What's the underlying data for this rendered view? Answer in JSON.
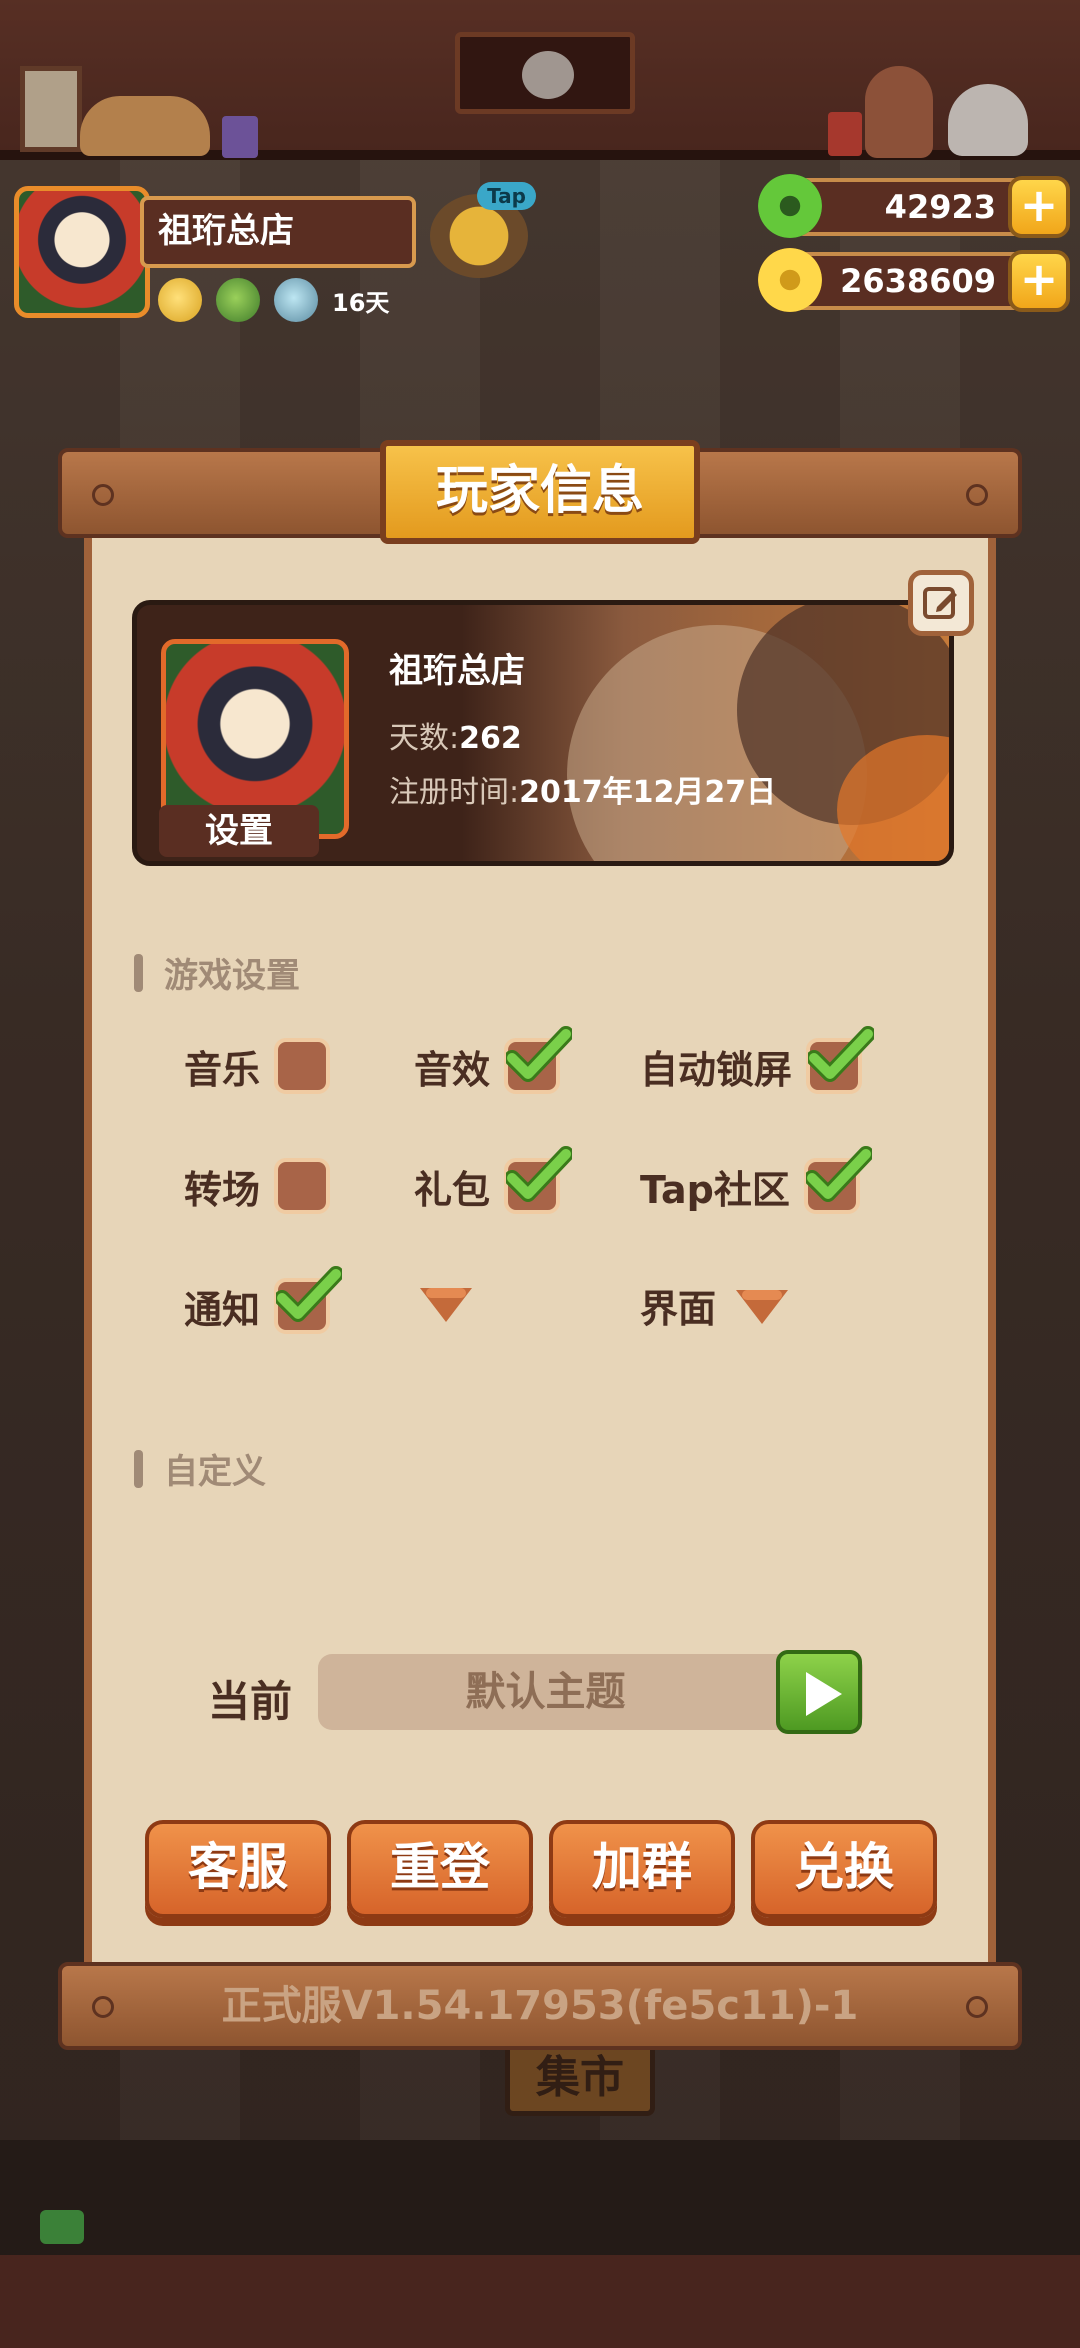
{
  "hud": {
    "shop_name": "祖珩总店",
    "tap_badge": "Tap",
    "days_label": "16天",
    "jade": "42923",
    "coins": "2638609",
    "plus": "+"
  },
  "panel": {
    "title": "玩家信息",
    "profile": {
      "name": "祖珩总店",
      "days_label": "天数:",
      "days_value": "262",
      "register_label": "注册时间:",
      "register_value": "2017年12月27日",
      "settings_button": "设置"
    },
    "game_settings": {
      "heading": "游戏设置",
      "options": [
        {
          "label": "音乐",
          "checked": false
        },
        {
          "label": "音效",
          "checked": true
        },
        {
          "label": "自动锁屏",
          "checked": true
        },
        {
          "label": "转场",
          "checked": false
        },
        {
          "label": "礼包",
          "checked": true
        },
        {
          "label": "Tap社区",
          "checked": true
        },
        {
          "label": "通知",
          "checked": true
        },
        {
          "label": "",
          "type": "dropdown"
        },
        {
          "label": "界面",
          "type": "dropdown"
        }
      ]
    },
    "custom": {
      "heading": "自定义",
      "current_label": "当前",
      "theme": "默认主题"
    },
    "buttons": {
      "service": "客服",
      "relogin": "重登",
      "join_group": "加群",
      "redeem": "兑换"
    },
    "version": "正式服V1.54.17953(fe5c11)-1"
  },
  "scene": {
    "market_sign": "集市"
  },
  "colors": {
    "panel_bg": "#e7d5b8",
    "button_orange": "#e57a3a",
    "check_green": "#6cc83a",
    "title_gold": "#f2b232"
  }
}
